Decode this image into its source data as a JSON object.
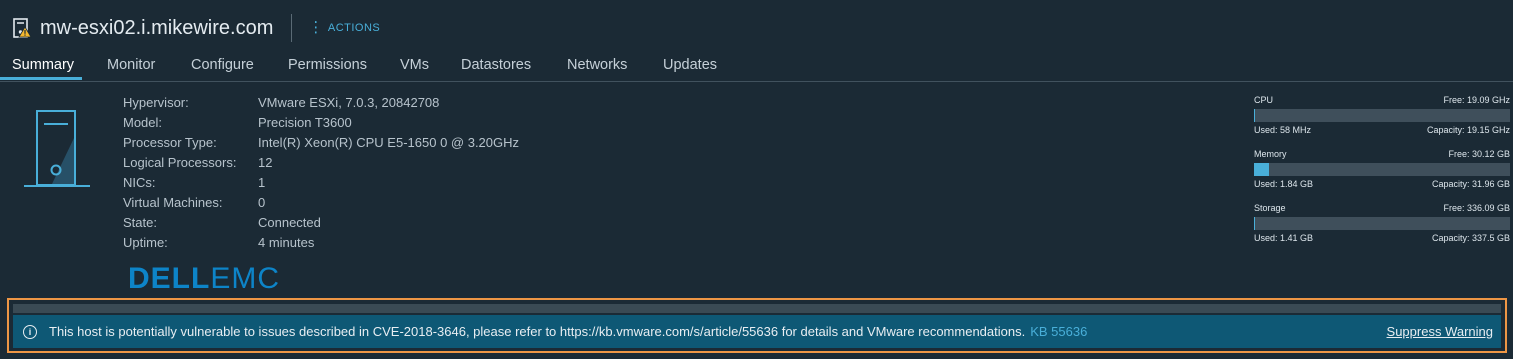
{
  "header": {
    "title": "mw-esxi02.i.mikewire.com",
    "actions_label": "ACTIONS",
    "host_icon": "host-warning-icon"
  },
  "tabs": [
    {
      "label": "Summary",
      "active": true
    },
    {
      "label": "Monitor"
    },
    {
      "label": "Configure"
    },
    {
      "label": "Permissions"
    },
    {
      "label": "VMs"
    },
    {
      "label": "Datastores"
    },
    {
      "label": "Networks"
    },
    {
      "label": "Updates"
    }
  ],
  "summary": {
    "rows": [
      {
        "label": "Hypervisor:",
        "value": "VMware ESXi, 7.0.3, 20842708"
      },
      {
        "label": "Model:",
        "value": "Precision T3600"
      },
      {
        "label": "Processor Type:",
        "value": "Intel(R) Xeon(R) CPU E5-1650 0 @ 3.20GHz"
      },
      {
        "label": "Logical Processors:",
        "value": "12"
      },
      {
        "label": "NICs:",
        "value": "1"
      },
      {
        "label": "Virtual Machines:",
        "value": "0"
      },
      {
        "label": "State:",
        "value": "Connected"
      },
      {
        "label": "Uptime:",
        "value": "4 minutes"
      }
    ],
    "vendor_logo": {
      "part1": "DELL",
      "part2": "EMC"
    }
  },
  "resources": {
    "cpu": {
      "name": "CPU",
      "free": "Free: 19.09 GHz",
      "used": "Used: 58 MHz",
      "capacity": "Capacity: 19.15 GHz",
      "used_fraction": 0.003
    },
    "memory": {
      "name": "Memory",
      "free": "Free: 30.12 GB",
      "used": "Used: 1.84 GB",
      "capacity": "Capacity: 31.96 GB",
      "used_fraction": 0.058
    },
    "storage": {
      "name": "Storage",
      "free": "Free: 336.09 GB",
      "used": "Used: 1.41 GB",
      "capacity": "Capacity: 337.5 GB",
      "used_fraction": 0.004
    }
  },
  "warning": {
    "text": "This host is potentially vulnerable to issues described in CVE-2018-3646, please refer to https://kb.vmware.com/s/article/55636 for details and VMware recommendations.",
    "link_label": "KB 55636",
    "suppress_label": "Suppress Warning",
    "info_icon_glyph": "i"
  },
  "colors": {
    "background": "#1b2a35",
    "accent": "#49afd9",
    "warning_bar": "#0e5875",
    "highlight_border": "#ee9645",
    "logo": "#0d84c8"
  }
}
